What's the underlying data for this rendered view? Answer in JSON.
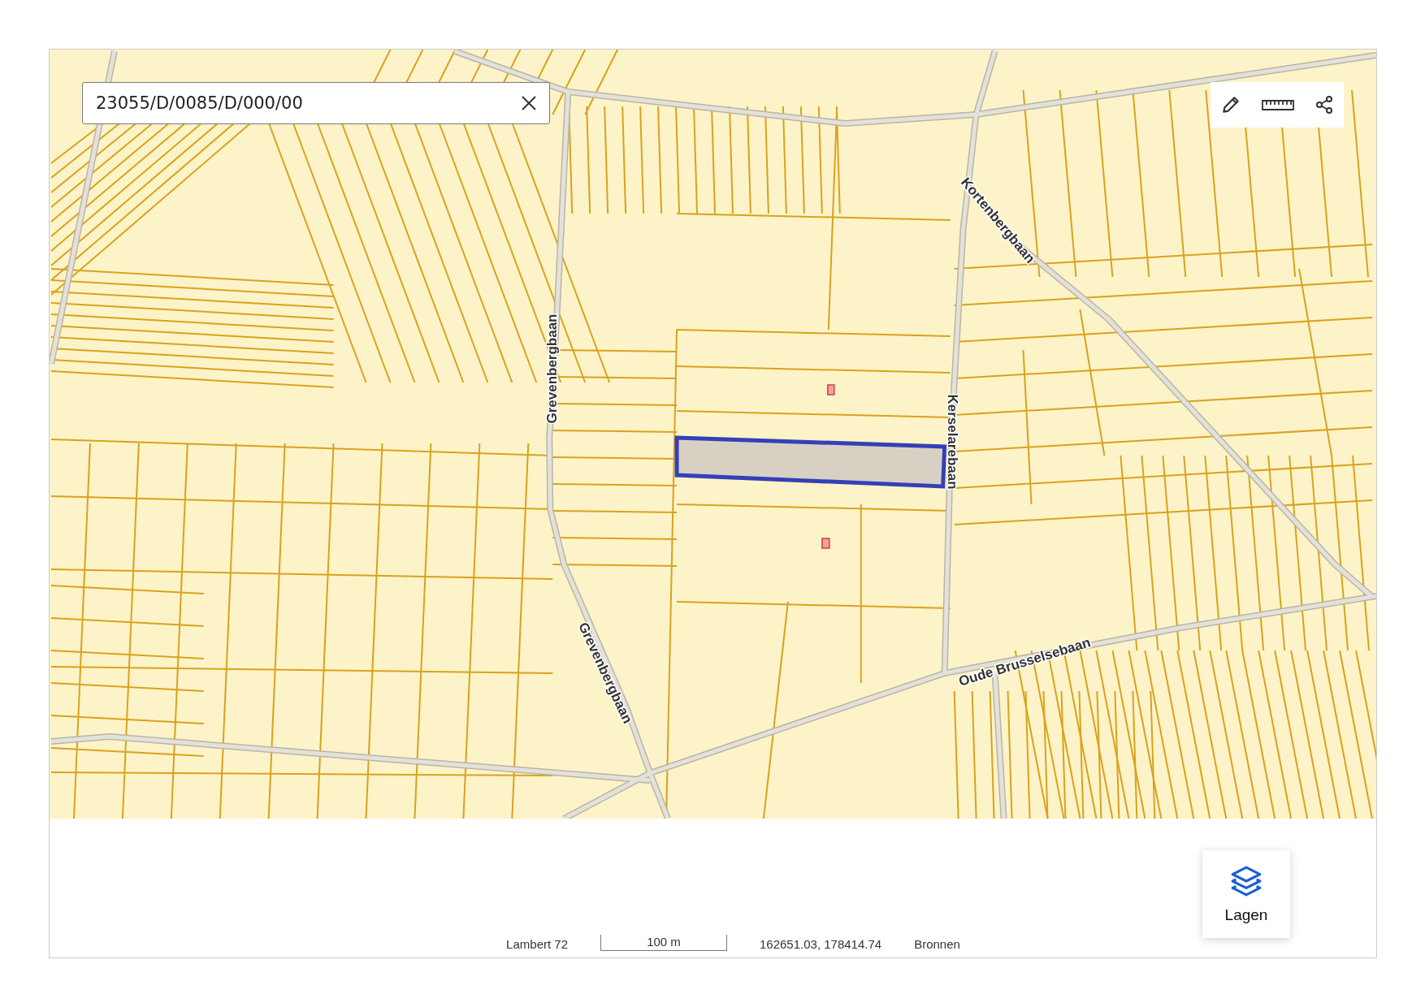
{
  "search": {
    "value": "23055/D/0085/D/000/00"
  },
  "map": {
    "road_labels": [
      {
        "text": "Grevenbergbaan"
      },
      {
        "text": "Grevenbergbaan"
      },
      {
        "text": "Kortenbergbaan"
      },
      {
        "text": "Kerselarebaan"
      },
      {
        "text": "Oude Brusselsebaan"
      }
    ]
  },
  "layers_button": {
    "label": "Lagen"
  },
  "footer": {
    "projection": "Lambert 72",
    "scale": "100 m",
    "coordinates": "162651.03, 178414.74",
    "sources": "Bronnen"
  }
}
